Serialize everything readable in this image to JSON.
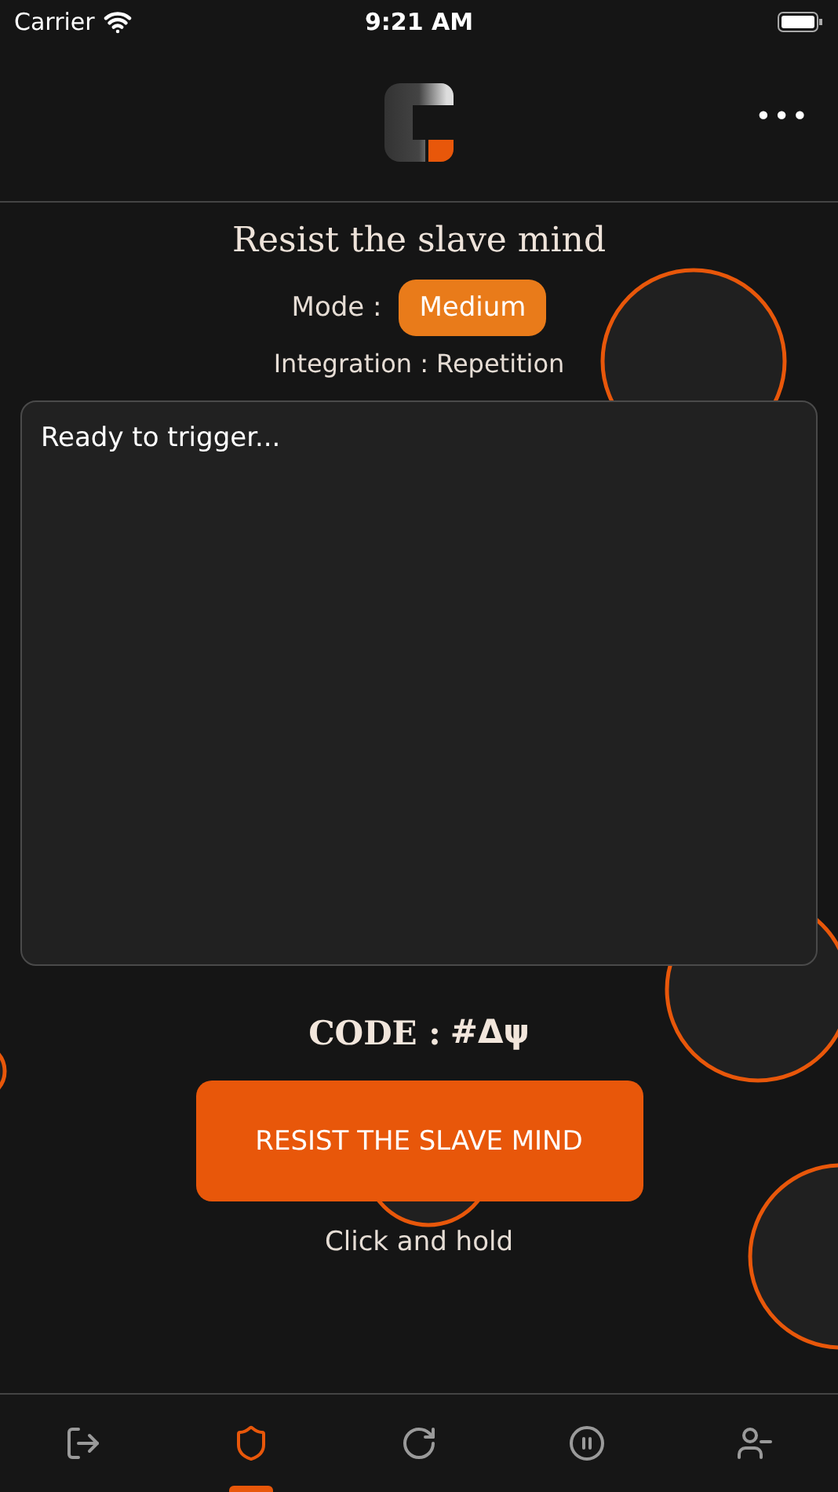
{
  "status_bar": {
    "carrier": "Carrier",
    "time": "9:21 AM"
  },
  "header": {
    "menu": "•••"
  },
  "title": "Resist the slave mind",
  "mode": {
    "label": "Mode :",
    "value": "Medium"
  },
  "integration": "Integration : Repetition",
  "input": {
    "placeholder": "Ready to trigger..."
  },
  "code": {
    "label": "CODE :",
    "value": "#Δψ"
  },
  "action_button": "RESIST THE SLAVE MIND",
  "hint": "Click and hold",
  "tabs": [
    {
      "selected": false
    },
    {
      "selected": true
    },
    {
      "selected": false
    },
    {
      "selected": false
    },
    {
      "selected": false
    }
  ]
}
